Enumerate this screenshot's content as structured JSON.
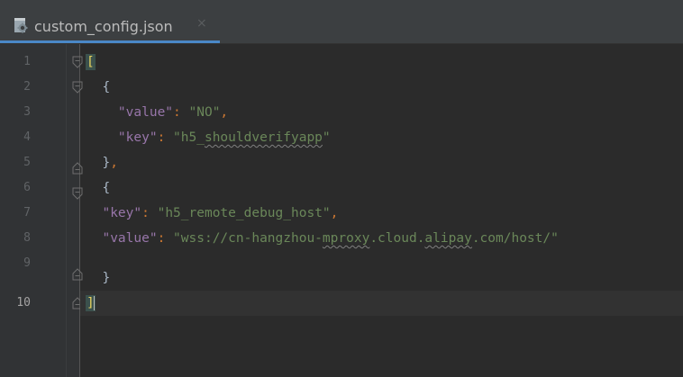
{
  "tab": {
    "filename": "custom_config.json",
    "close_glyph": "×",
    "icon": "json-file-icon"
  },
  "line_numbers": [
    "1",
    "2",
    "3",
    "4",
    "5",
    "6",
    "7",
    "8",
    "9",
    "10"
  ],
  "current_line": 10,
  "code": {
    "l1_open": "[",
    "l2_open": "{",
    "l3_key": "\"value\"",
    "l3_sep": ": ",
    "l3_val": "\"NO\"",
    "l3_comma": ",",
    "l4_key": "\"key\"",
    "l4_sep": ": ",
    "l4_val_a": "\"h5_",
    "l4_val_b": "shouldverifyapp",
    "l4_val_c": "\"",
    "l5_close": "}",
    "l5_comma": ",",
    "l6_open": "{",
    "l7_key": "\"key\"",
    "l7_sep": ": ",
    "l7_val": "\"h5_remote_debug_host\"",
    "l7_comma": ",",
    "l8_key": "\"value\"",
    "l8_sep": ": ",
    "l8_val_a": "\"wss://cn-hangzhou-",
    "l8_val_b": "mproxy",
    "l8_val_c": ".cloud.",
    "l8_val_d": "alipay",
    "l8_val_e": ".com/host/\"",
    "l9_close": "}",
    "l10_close": "]"
  },
  "colors": {
    "background": "#2b2b2b",
    "gutter": "#313335",
    "tab_accent": "#4a88c7",
    "json_key": "#9876aa",
    "json_string": "#6a8759",
    "punctuation": "#cc7832",
    "bracket_match": "#e8d35f"
  }
}
